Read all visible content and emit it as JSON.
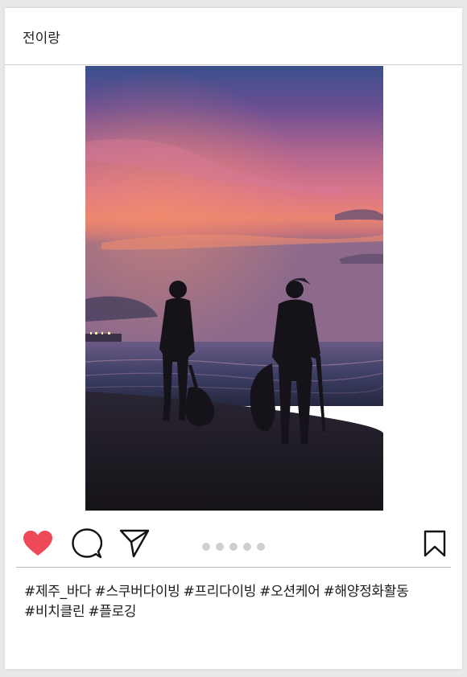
{
  "post": {
    "username": "전이랑",
    "image_alt": "Silhouettes of two people collecting trash on a beach at sunset",
    "slide_count": 5,
    "hashtags": [
      "#제주_바다",
      "#스쿠버다이빙",
      "#프리다이빙",
      "#오션케어",
      "#해양정화활동",
      "#비치클린",
      "#플로깅"
    ]
  },
  "icons": {
    "like": "heart-icon",
    "comment": "comment-bubble-icon",
    "share": "paper-plane-icon",
    "save": "bookmark-icon"
  },
  "colors": {
    "like_active": "#ed4956",
    "dot_inactive": "#cfcfcf",
    "divider": "#bdbdbd"
  }
}
